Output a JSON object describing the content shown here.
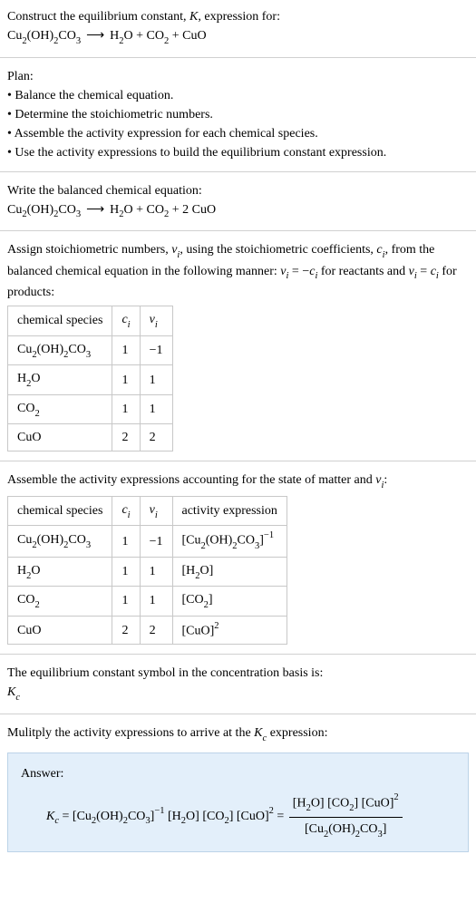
{
  "header": {
    "prompt_line1_text": "Construct the equilibrium constant, ",
    "prompt_line1_var": "K",
    "prompt_line1_suffix": ", expression for:"
  },
  "equation1": {
    "lhs": "Cu",
    "lhs_sub": "2",
    "lhs2": "(OH)",
    "lhs2_sub": "2",
    "lhs3": "CO",
    "lhs3_sub": "3",
    "arrow": "⟶",
    "rhs1": "H",
    "rhs1_sub": "2",
    "rhs1b": "O + CO",
    "rhs1b_sub": "2",
    "rhs1c": " + CuO"
  },
  "plan": {
    "title": "Plan:",
    "b1": "• Balance the chemical equation.",
    "b2": "• Determine the stoichiometric numbers.",
    "b3": "• Assemble the activity expression for each chemical species.",
    "b4": "• Use the activity expressions to build the equilibrium constant expression."
  },
  "balanced": {
    "title": "Write the balanced chemical equation:",
    "lhs": "Cu",
    "lhs_sub": "2",
    "lhs2": "(OH)",
    "lhs2_sub": "2",
    "lhs3": "CO",
    "lhs3_sub": "3",
    "arrow": "⟶",
    "rhs1": "H",
    "rhs1_sub": "2",
    "rhs1b": "O + CO",
    "rhs1b_sub": "2",
    "rhs1c": " + 2 CuO"
  },
  "assign": {
    "text1": "Assign stoichiometric numbers, ",
    "var_nu": "ν",
    "sub_i": "i",
    "text2": ", using the stoichiometric coefficients, ",
    "var_c": "c",
    "text3": ", from the balanced chemical equation in the following manner: ",
    "eq_a": "ν",
    "eq_b": " = −",
    "eq_c": "c",
    "text4": " for reactants and ",
    "eq_d": "ν",
    "eq_e": " = ",
    "eq_f": "c",
    "text5": " for products:"
  },
  "table1": {
    "h1": "chemical species",
    "h2": "c",
    "h2s": "i",
    "h3": "ν",
    "h3s": "i",
    "rows": [
      {
        "sp": "Cu2(OH)2CO3",
        "c": "1",
        "nu": "−1"
      },
      {
        "sp": "H2O",
        "c": "1",
        "nu": "1"
      },
      {
        "sp": "CO2",
        "c": "1",
        "nu": "1"
      },
      {
        "sp": "CuO",
        "c": "2",
        "nu": "2"
      }
    ]
  },
  "assemble": {
    "text1": "Assemble the activity expressions accounting for the state of matter and ",
    "var": "ν",
    "sub": "i",
    "suffix": ":"
  },
  "table2": {
    "h1": "chemical species",
    "h2": "c",
    "h2s": "i",
    "h3": "ν",
    "h3s": "i",
    "h4": "activity expression"
  },
  "kc": {
    "line1": "The equilibrium constant symbol in the concentration basis is:",
    "var": "K",
    "sub": "c"
  },
  "mult": {
    "text1": "Mulitply the activity expressions to arrive at the ",
    "var": "K",
    "sub": "c",
    "text2": " expression:"
  },
  "answer": {
    "label": "Answer:"
  }
}
